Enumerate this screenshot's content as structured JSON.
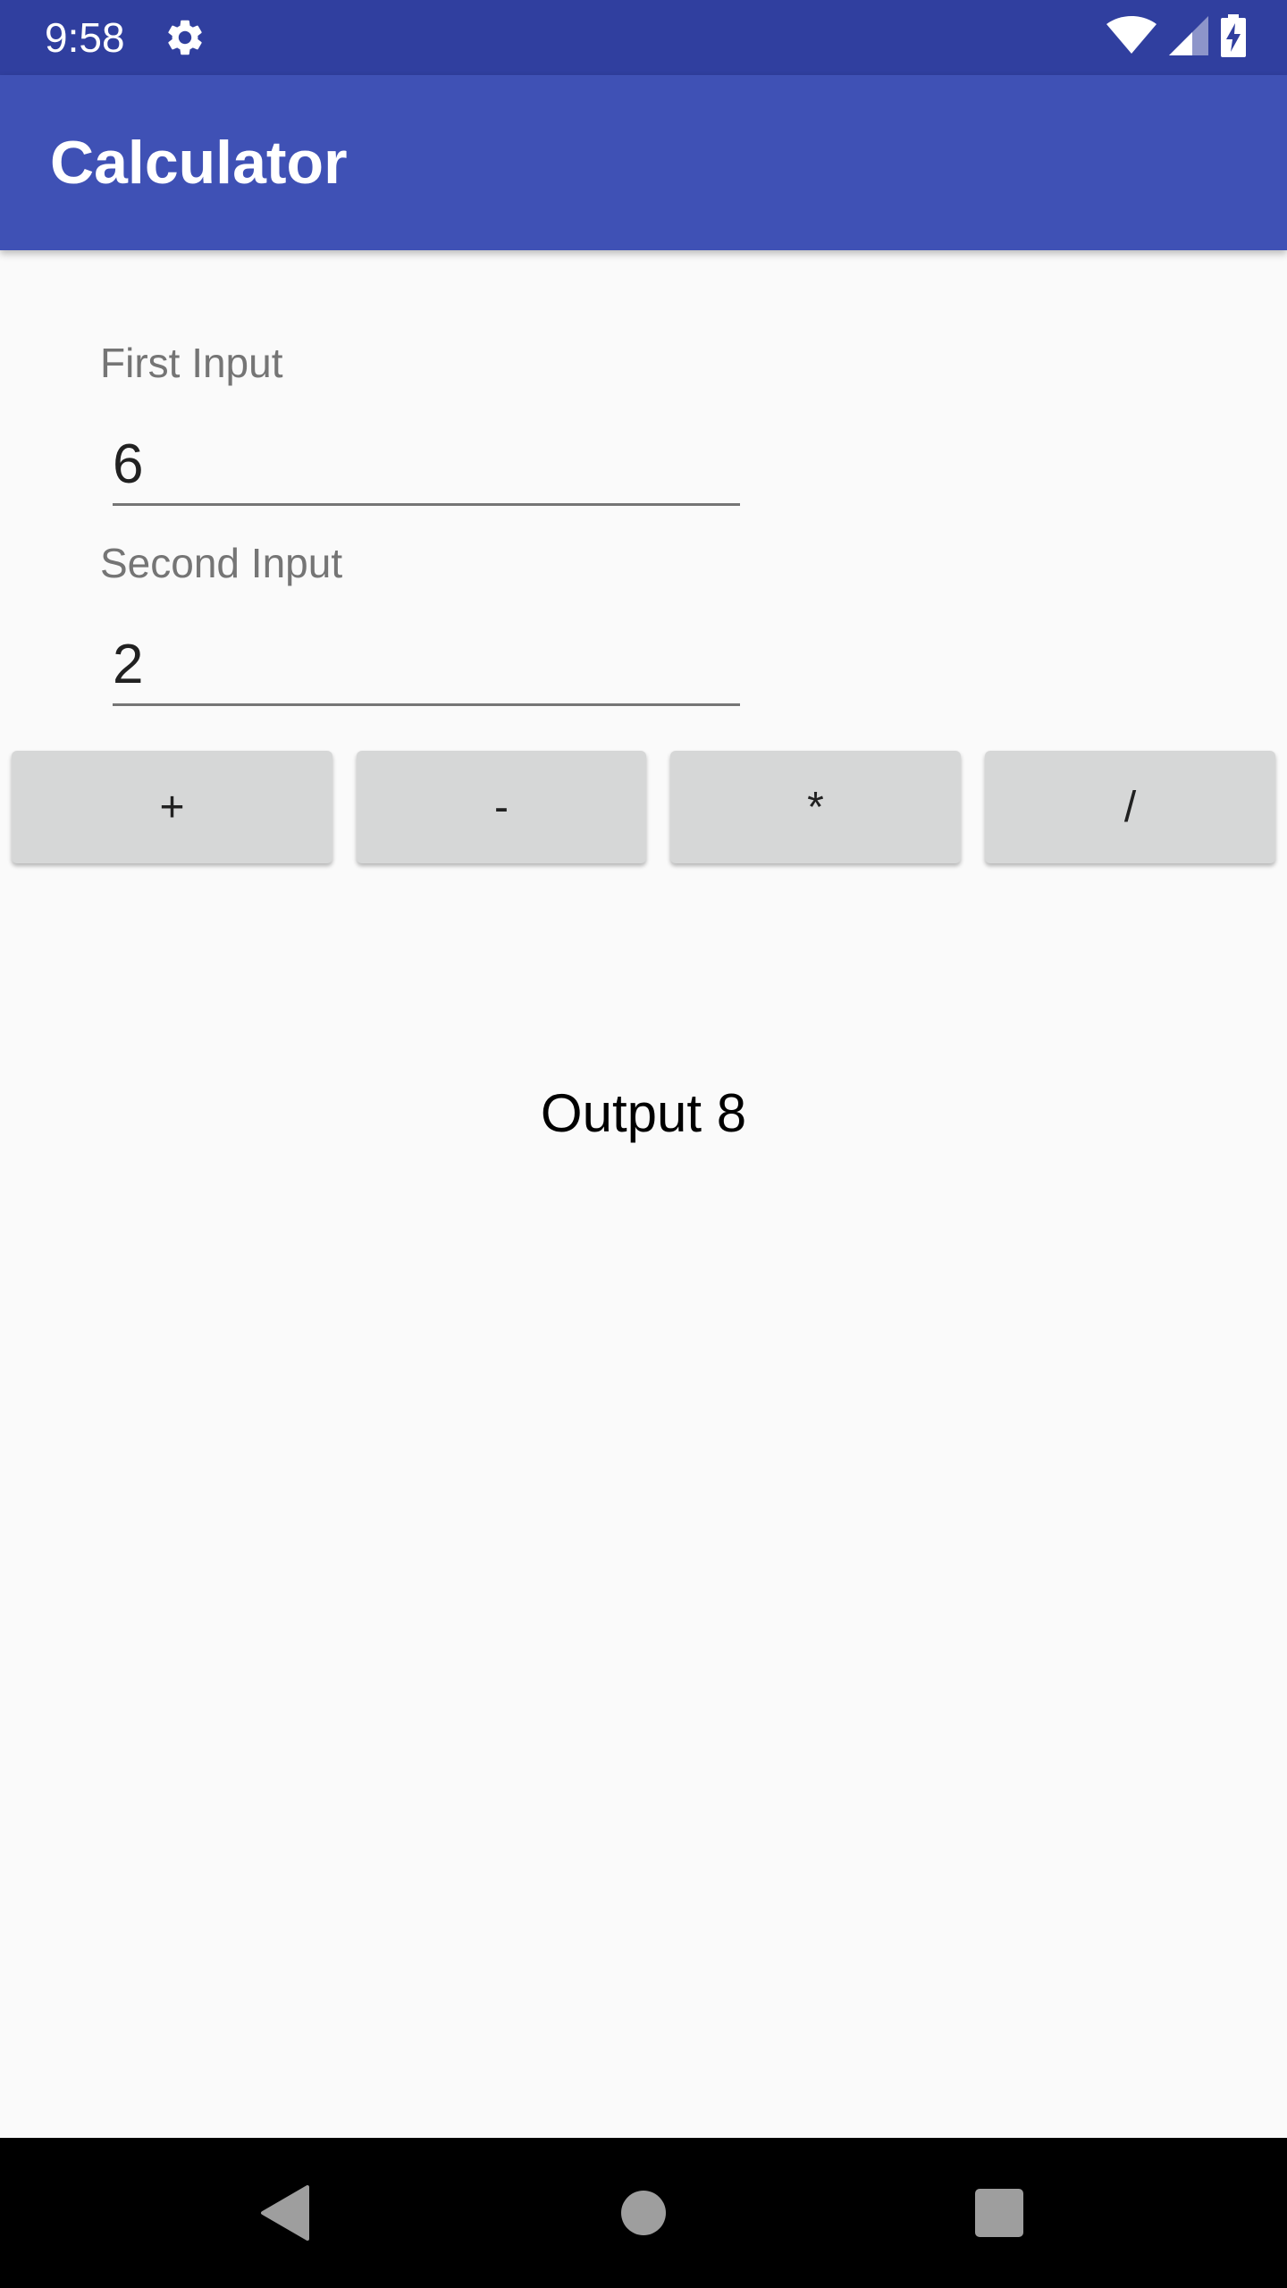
{
  "status_bar": {
    "time": "9:58",
    "icons": [
      "gear-icon",
      "wifi-icon",
      "signal-icon",
      "battery-charging-icon"
    ],
    "background_color": "#303f9f"
  },
  "app_bar": {
    "title": "Calculator",
    "background_color": "#3f51b5"
  },
  "form": {
    "first_input": {
      "label": "First Input",
      "value": "6"
    },
    "second_input": {
      "label": "Second Input",
      "value": "2"
    }
  },
  "operations": [
    {
      "label": "+"
    },
    {
      "label": "-"
    },
    {
      "label": "*"
    },
    {
      "label": "/"
    }
  ],
  "output": {
    "text": "Output 8"
  },
  "nav_bar": {
    "icons": [
      "back-icon",
      "home-icon",
      "recents-icon"
    ]
  },
  "colors": {
    "background": "#fafafa",
    "button": "#d6d7d7",
    "label": "#757575"
  }
}
